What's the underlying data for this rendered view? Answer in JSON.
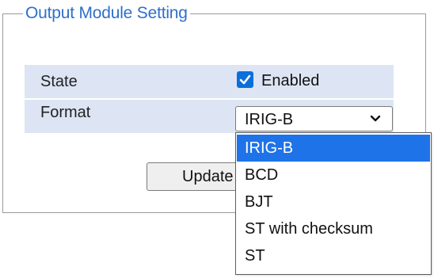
{
  "panel": {
    "legend": "Output Module Setting"
  },
  "state": {
    "label": "State",
    "checkbox_checked": true,
    "checkbox_label": "Enabled"
  },
  "format": {
    "label": "Format",
    "selected": "IRIG-B",
    "options": [
      "IRIG-B",
      "BCD",
      "BJT",
      "ST with checksum",
      "ST"
    ]
  },
  "actions": {
    "update_label": "Update"
  },
  "colors": {
    "legend_text": "#2f6fcb",
    "row_background": "#dde5f4",
    "checkbox_fill": "#0a6fdc",
    "selected_option": "#1e73e8"
  },
  "icons": {
    "checkbox": "check-icon",
    "select": "chevron-down-icon"
  }
}
